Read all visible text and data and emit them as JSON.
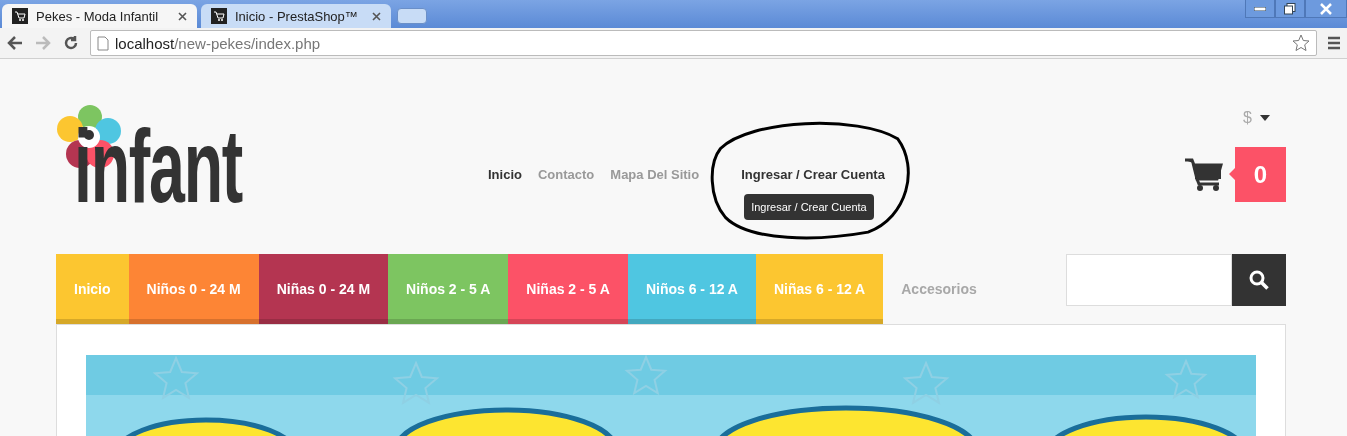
{
  "browser": {
    "tabs": [
      {
        "title": "Pekes - Moda Infantil",
        "selected": true
      },
      {
        "title": "Inicio - PrestaShop™",
        "selected": false
      }
    ],
    "address": {
      "host": "localhost",
      "path": "/new-pekes/index.php"
    }
  },
  "header": {
    "logo": "infant",
    "links": [
      {
        "label": "Inicio",
        "selected": true
      },
      {
        "label": "Contacto",
        "selected": false
      },
      {
        "label": "Mapa Del Sitio",
        "selected": false
      },
      {
        "label": "Ingresar / Crear Cuenta",
        "selected": true
      }
    ],
    "tooltip": "Ingresar / Crear Cuenta",
    "currency": "$",
    "cart_count": "0"
  },
  "menu": [
    {
      "label": "Inicio",
      "color": "#fcc630"
    },
    {
      "label": "Niños 0 - 24 M",
      "color": "#fd8535"
    },
    {
      "label": "Niñas 0 - 24 M",
      "color": "#b43551"
    },
    {
      "label": "Niños 2 - 5 A",
      "color": "#7dc561"
    },
    {
      "label": "Niñas 2 - 5 A",
      "color": "#fc5267"
    },
    {
      "label": "Niños 6 - 12 A",
      "color": "#4fc6e1"
    },
    {
      "label": "Niñas 6 - 12 A",
      "color": "#fcc630"
    },
    {
      "label": "Accesorios",
      "color": "#f8f8f8"
    }
  ]
}
